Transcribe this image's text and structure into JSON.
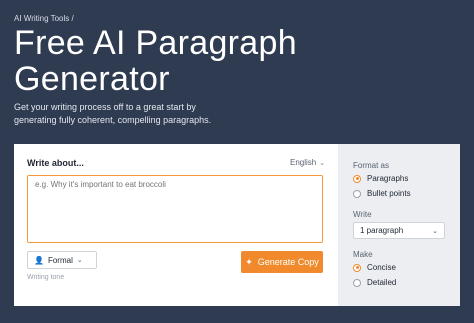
{
  "breadcrumb": "AI Writing Tools /",
  "title_line1": "Free AI Paragraph",
  "title_line2": "Generator",
  "subtitle": "Get your writing process off to a great start by generating fully coherent, compelling paragraphs.",
  "form": {
    "write_about_label": "Write about...",
    "language": "English",
    "textarea_placeholder": "e.g. Why it's important to eat broccoli",
    "tone_value": "Formal",
    "tone_label": "Writing tone",
    "generate_label": "Generate Copy"
  },
  "options": {
    "format_label": "Format as",
    "format_options": [
      "Paragraphs",
      "Bullet points"
    ],
    "format_selected": "Paragraphs",
    "write_label": "Write",
    "write_value": "1 paragraph",
    "make_label": "Make",
    "make_options": [
      "Concise",
      "Detailed"
    ],
    "make_selected": "Concise"
  },
  "colors": {
    "header_bg": "#2f3b51",
    "accent": "#f08a2c"
  }
}
